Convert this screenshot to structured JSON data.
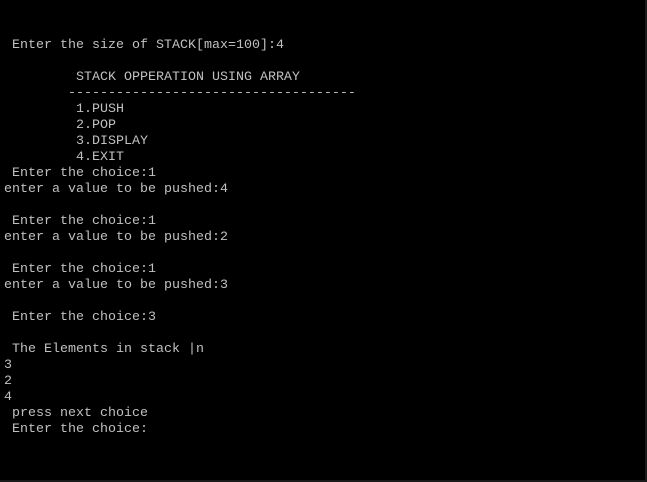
{
  "console": {
    "lines": [
      " Enter the size of STACK[max=100]:4",
      "",
      "         STACK OPPERATION USING ARRAY",
      "        ------------------------------------",
      "         1.PUSH",
      "         2.POP",
      "         3.DISPLAY",
      "         4.EXIT",
      " Enter the choice:1",
      "enter a value to be pushed:4",
      "",
      " Enter the choice:1",
      "enter a value to be pushed:2",
      "",
      " Enter the choice:1",
      "enter a value to be pushed:3",
      "",
      " Enter the choice:3",
      "",
      " The Elements in stack |n",
      "3",
      "2",
      "4",
      " press next choice",
      " Enter the choice:"
    ]
  },
  "colors": {
    "background": "#000000",
    "text": "#c0c0c0"
  }
}
